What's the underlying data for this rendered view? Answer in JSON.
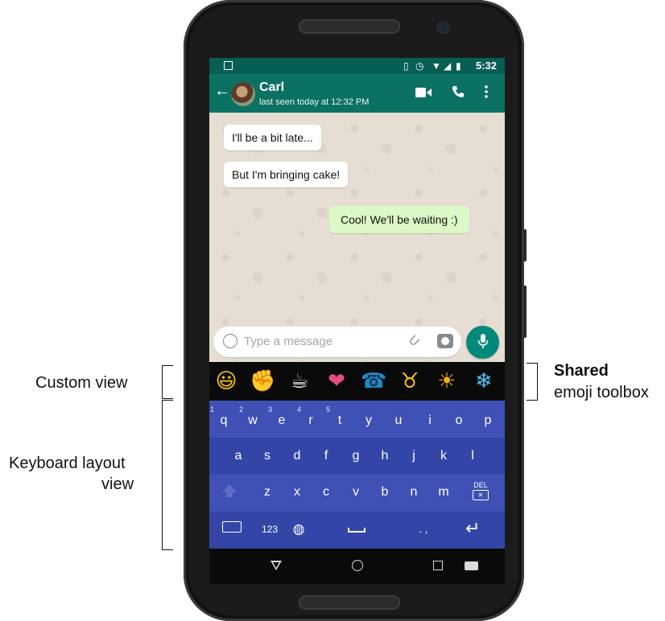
{
  "annotations": {
    "custom_view": "Custom view",
    "keyboard_layout_view_line1": "Keyboard layout",
    "keyboard_layout_view_line2": "view",
    "shared_bold": "Shared",
    "shared_rest": "emoji toolbox"
  },
  "status_bar": {
    "time": "5:32"
  },
  "app_bar": {
    "contact_name": "Carl",
    "contact_status": "last seen today at 12:32 PM"
  },
  "messages": [
    {
      "direction": "in",
      "text": "I'll be a bit late..."
    },
    {
      "direction": "in",
      "text": "But I'm bringing cake!"
    },
    {
      "direction": "out",
      "text": "Cool! We'll be waiting :)"
    }
  ],
  "composer": {
    "placeholder": "Type a message"
  },
  "emoji_toolbox": [
    "😃",
    "✊",
    "☕",
    "❤",
    "☎",
    "♉",
    "☀",
    "❄"
  ],
  "keyboard": {
    "row1": [
      {
        "key": "q",
        "num": "1"
      },
      {
        "key": "w",
        "num": "2"
      },
      {
        "key": "e",
        "num": "3"
      },
      {
        "key": "r",
        "num": "4"
      },
      {
        "key": "t",
        "num": "5"
      },
      {
        "key": "y",
        "num": ""
      },
      {
        "key": "u",
        "num": ""
      },
      {
        "key": "i",
        "num": ""
      },
      {
        "key": "o",
        "num": ""
      },
      {
        "key": "p",
        "num": ""
      }
    ],
    "row2": [
      "a",
      "s",
      "d",
      "f",
      "g",
      "h",
      "j",
      "k",
      "l"
    ],
    "row3": [
      "z",
      "x",
      "c",
      "v",
      "b",
      "n",
      "m"
    ],
    "del_label": "DEL",
    "numbers_label": "123",
    "punct_label": ". ,"
  },
  "icons": {
    "back": "back-arrow-icon",
    "video": "video-call-icon",
    "call": "phone-call-icon",
    "menu": "overflow-menu-icon",
    "mic": "microphone-icon",
    "globe": "globe-icon"
  },
  "colors": {
    "app_bar": "#0b7263",
    "status_bar": "#075e54",
    "keyboard": "#3f51b5",
    "out_bubble": "#dcf8c6",
    "mic_button": "#00897b"
  }
}
